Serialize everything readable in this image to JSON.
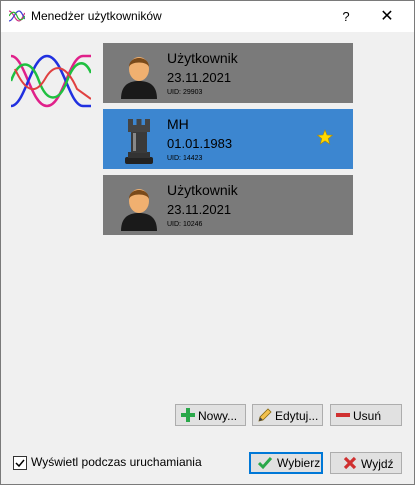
{
  "window": {
    "title": "Menedżer użytkowników",
    "help": "?",
    "close": "✕"
  },
  "users": [
    {
      "name": "Użytkownik",
      "date": "23.11.2021",
      "uid": "UID: 29903",
      "avatar": "person-avatar-icon",
      "selected": false,
      "favorite": false
    },
    {
      "name": "MH",
      "date": "01.01.1983",
      "uid": "UID: 14423",
      "avatar": "chess-rook-avatar-icon",
      "selected": true,
      "favorite": true
    },
    {
      "name": "Użytkownik",
      "date": "23.11.2021",
      "uid": "UID: 10246",
      "avatar": "person-avatar-icon",
      "selected": false,
      "favorite": false
    }
  ],
  "actions": {
    "new": "Nowy...",
    "edit": "Edytuj...",
    "delete": "Usuń"
  },
  "startup_checkbox": {
    "label": "Wyświetl podczas uruchamiania",
    "checked": true
  },
  "footer": {
    "select": "Wybierz",
    "exit": "Wyjdź"
  },
  "colors": {
    "card": "#7a7a7a",
    "selected": "#3c86d0",
    "star": "#ffd800"
  }
}
